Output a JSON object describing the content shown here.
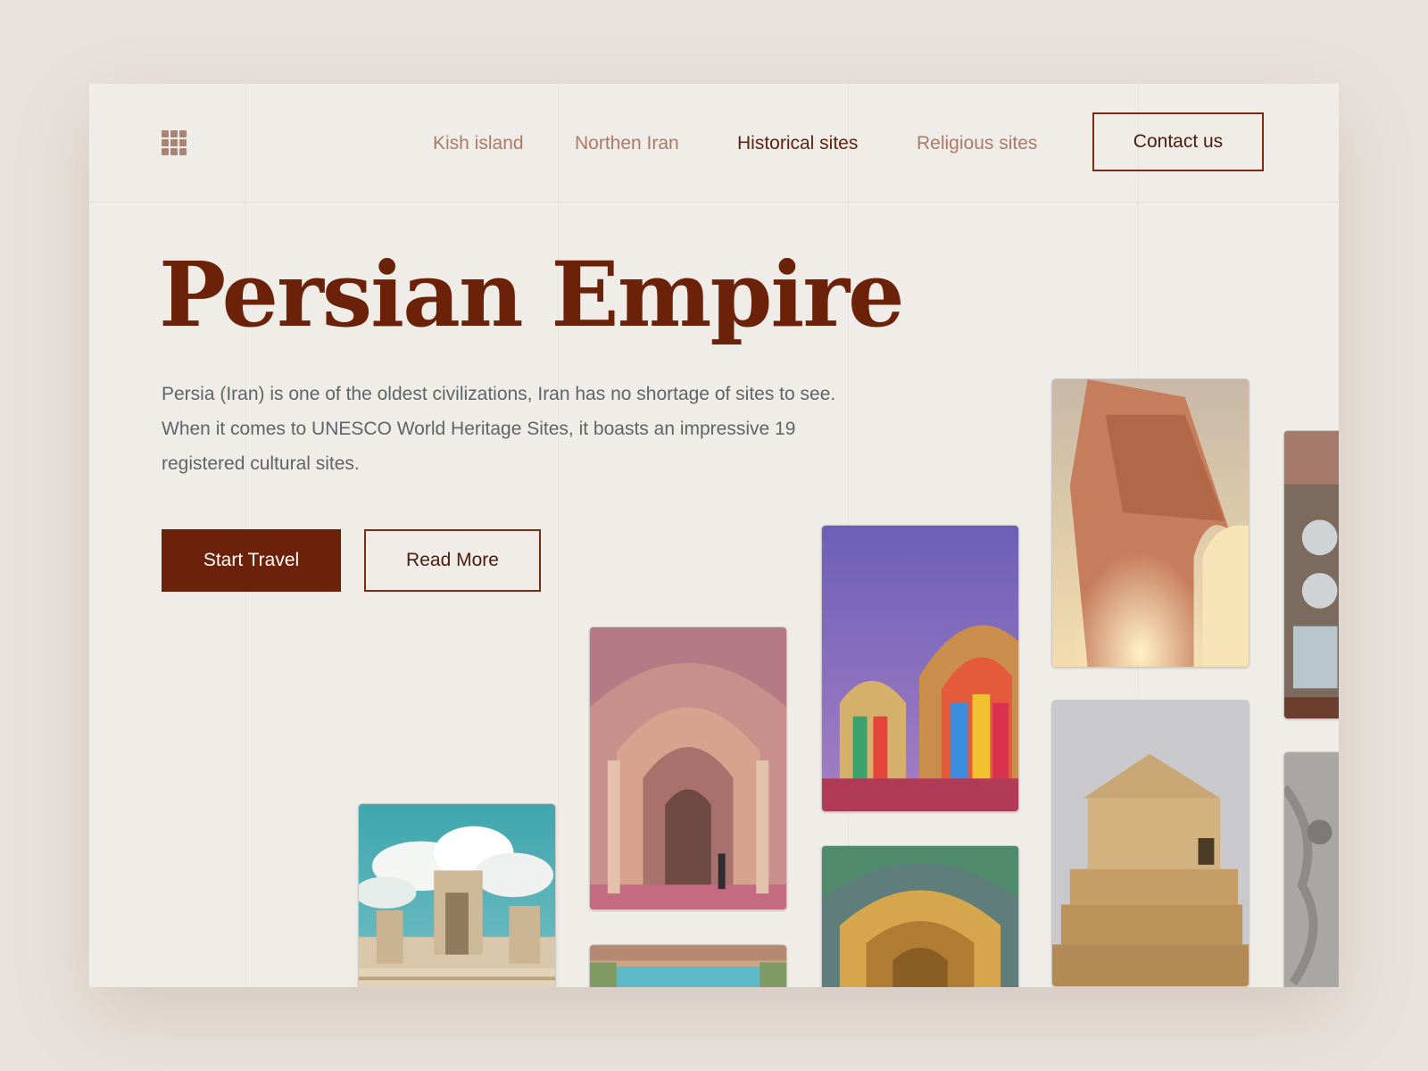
{
  "nav": {
    "menu_icon": "grid-menu-icon",
    "links": [
      {
        "label": "Kish island",
        "active": false
      },
      {
        "label": "Northen Iran",
        "active": false
      },
      {
        "label": "Historical sites",
        "active": true
      },
      {
        "label": "Religious sites",
        "active": false
      }
    ],
    "contact_label": "Contact us"
  },
  "hero": {
    "title": "Persian Empire",
    "description": "Persia (Iran) is one of the oldest civilizations, Iran has no shortage of sites to see. When it comes to UNESCO World Heritage Sites, it boasts an impressive 19 registered cultural sites.",
    "primary_button": "Start Travel",
    "secondary_button": "Read More"
  },
  "colors": {
    "brand": "#6b2208",
    "background": "#f0ede9",
    "nav_text": "#a87c68",
    "body_text": "#5e6566"
  },
  "gallery": [
    {
      "name": "persepolis-ruins-photo"
    },
    {
      "name": "mosque-arch-interior-photo"
    },
    {
      "name": "pool-courtyard-photo"
    },
    {
      "name": "stained-glass-mosque-photo"
    },
    {
      "name": "tiled-vault-photo"
    },
    {
      "name": "azadi-tower-photo"
    },
    {
      "name": "cyrus-tomb-photo"
    },
    {
      "name": "mirror-mosaic-photo"
    },
    {
      "name": "stone-relief-photo"
    }
  ]
}
